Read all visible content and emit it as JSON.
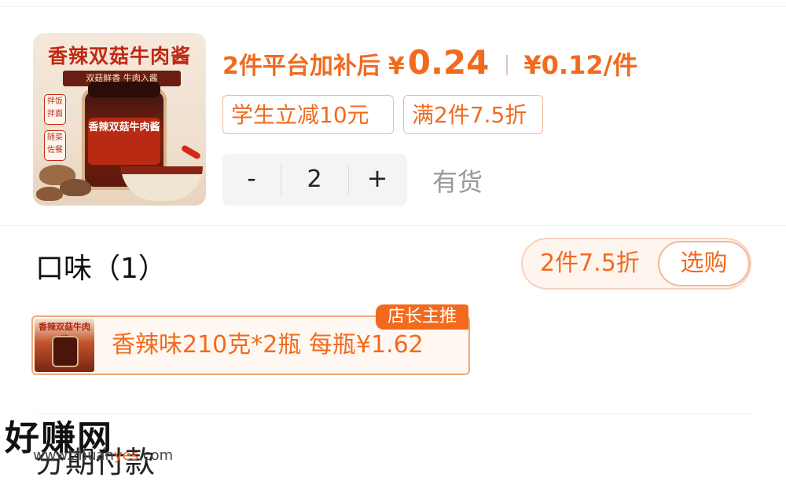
{
  "product": {
    "image_title": "香辣双菇牛肉酱",
    "image_subtitle": "双菇鲜香 牛肉入酱",
    "image_tag_1": "拌饭拌面",
    "image_tag_2": "随菜佐餐",
    "jar_label": "香辣双菇牛肉酱"
  },
  "price": {
    "label": "2件平台加补后",
    "currency": "¥",
    "value": "0.24",
    "unit_price": "¥0.12",
    "unit_suffix": "/件",
    "color": "#f26a1e"
  },
  "promotions": [
    "学生立减10元",
    "满2件7.5折"
  ],
  "quantity": {
    "minus_label": "-",
    "value": "2",
    "plus_label": "+",
    "stock_status": "有货"
  },
  "flavor": {
    "title": "口味（1）",
    "discount_text": "2件7.5折",
    "choose_button": "选购"
  },
  "option": {
    "thumb_title": "香辣双菇牛肉酱",
    "text": "香辣味210克*2瓶  每瓶¥1.62",
    "badge": "店长主推"
  },
  "installment": {
    "title": "分期付款"
  },
  "watermark": {
    "text": "好赚网",
    "url_prefix": "www.zhuan",
    "url_highlight": "yes",
    "url_suffix": ".com"
  }
}
